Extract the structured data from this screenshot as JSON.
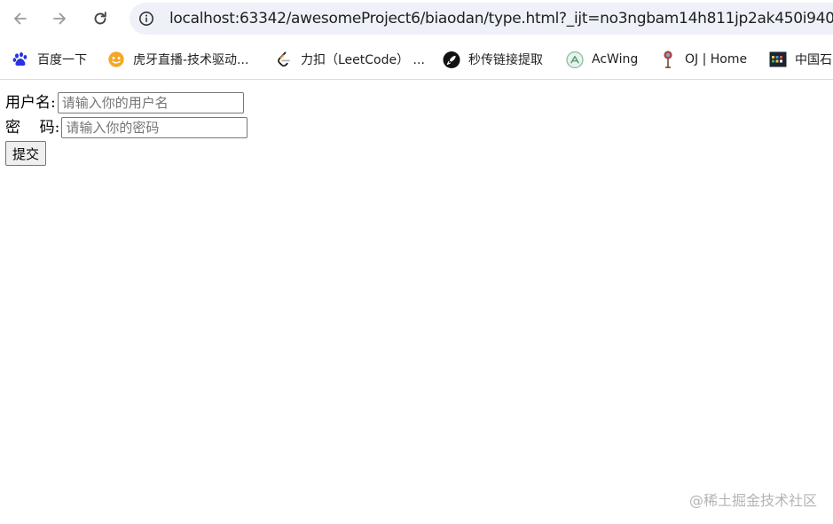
{
  "browser": {
    "url": "localhost:63342/awesomeProject6/biaodan/type.html?_ijt=no3ngbam14h811jp2ak450i940",
    "icons": {
      "back": "arrow-left-icon",
      "forward": "arrow-right-icon",
      "reload": "reload-icon",
      "site_info": "info-circle-icon"
    },
    "colors": {
      "omnibox_bg": "#eef1f8",
      "nav_icon": "#8a8a8a"
    }
  },
  "bookmarks": [
    {
      "label": "百度一下",
      "icon": "baidu-paw-icon"
    },
    {
      "label": "虎牙直播-技术驱动...",
      "icon": "huya-icon"
    },
    {
      "label": "力扣（LeetCode） ...",
      "icon": "leetcode-icon"
    },
    {
      "label": "秒传链接提取",
      "icon": "rocket-icon"
    },
    {
      "label": "AcWing",
      "icon": "acwing-icon"
    },
    {
      "label": "OJ | Home",
      "icon": "oj-icon"
    },
    {
      "label": "中国石",
      "icon": "grid-logo-icon"
    }
  ],
  "form": {
    "username_label": "用户名:",
    "username_placeholder": "请输入你的用户名",
    "username_value": "",
    "password_label": "密    码:",
    "password_placeholder": "请输入你的密码",
    "password_value": "",
    "submit_label": "提交"
  },
  "watermark": "@稀土掘金技术社区"
}
